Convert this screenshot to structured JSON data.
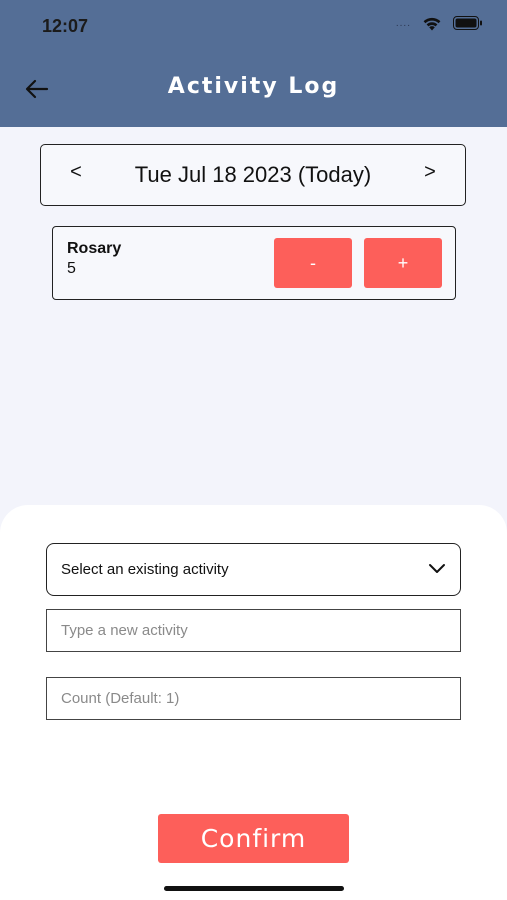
{
  "status_bar": {
    "time": "12:07",
    "dots": "....",
    "icons": [
      "wifi-icon",
      "battery-icon"
    ]
  },
  "header": {
    "title": "Activity Log",
    "back_icon": "arrow-left-icon",
    "background": "#546e96"
  },
  "date_nav": {
    "prev_label": "<",
    "date_label": "Tue Jul 18 2023 (Today)",
    "next_label": ">"
  },
  "activities": [
    {
      "name": "Rosary",
      "count": "5",
      "decrement_label": "-",
      "increment_label": "+"
    }
  ],
  "form": {
    "select_label": "Select an existing activity",
    "new_activity_placeholder": "Type a new activity",
    "new_activity_value": "",
    "count_placeholder": "Count (Default: 1)",
    "count_value": "",
    "confirm_label": "Confirm"
  },
  "colors": {
    "accent": "#fd5f5a",
    "header": "#546e96",
    "page_bg": "#f3f4fb"
  }
}
